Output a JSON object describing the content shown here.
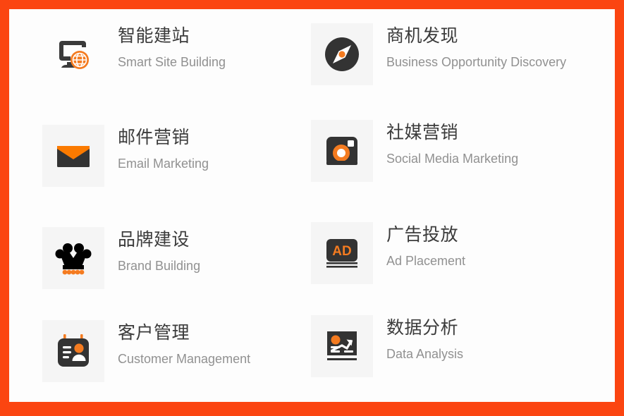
{
  "page": {
    "border_color": "#fb4511",
    "background_color": "#fdfdfd",
    "tile_background": "#f5f5f5",
    "accent_color": "#f47b20",
    "dark_color": "#333333",
    "title_color": "#3b3b3b",
    "subtitle_color": "#919191"
  },
  "services": [
    {
      "icon": "monitor-globe-icon",
      "title_cn": "智能建站",
      "title_en": "Smart Site Building",
      "has_tile": false
    },
    {
      "icon": "compass-icon",
      "title_cn": "商机发现",
      "title_en": "Business Opportunity Discovery",
      "has_tile": true
    },
    {
      "icon": "envelope-icon",
      "title_cn": "邮件营销",
      "title_en": "Email Marketing",
      "has_tile": true
    },
    {
      "icon": "camera-social-icon",
      "title_cn": "社媒营销",
      "title_en": "Social Media Marketing",
      "has_tile": true
    },
    {
      "icon": "crown-icon",
      "title_cn": "品牌建设",
      "title_en": "Brand Building",
      "has_tile": true
    },
    {
      "icon": "ad-billboard-icon",
      "title_cn": "广告投放",
      "title_en": "Ad Placement",
      "has_tile": true,
      "icon_label": "AD"
    },
    {
      "icon": "customer-card-icon",
      "title_cn": "客户管理",
      "title_en": "Customer Management",
      "has_tile": true
    },
    {
      "icon": "chart-analysis-icon",
      "title_cn": "数据分析",
      "title_en": "Data Analysis",
      "has_tile": true
    }
  ]
}
